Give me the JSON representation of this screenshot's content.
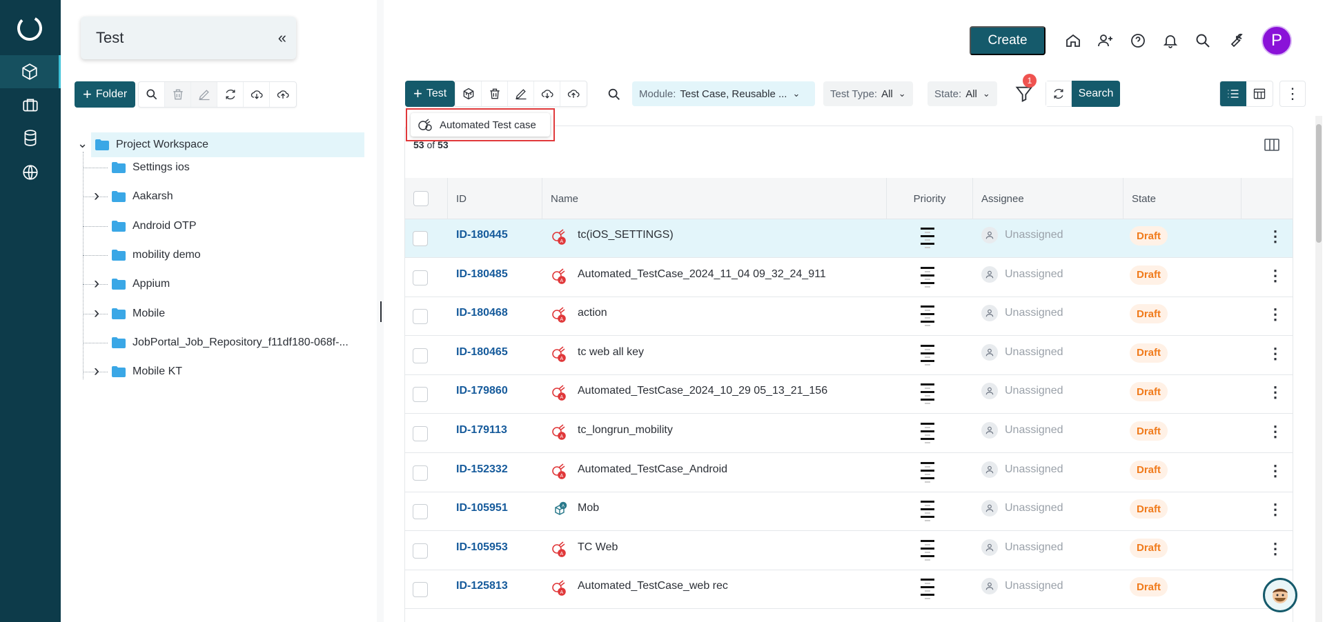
{
  "nav": {
    "items": [
      "logo-icon",
      "cube-icon",
      "briefcase-icon",
      "database-icon",
      "globe-icon"
    ]
  },
  "project": {
    "title": "Test",
    "collapse_glyph": "«"
  },
  "folder_toolbar": {
    "add_folder_label": "Folder"
  },
  "tree": {
    "root": "Project Workspace",
    "items": [
      {
        "label": "Settings ios",
        "expandable": false
      },
      {
        "label": "Aakarsh",
        "expandable": true
      },
      {
        "label": "Android OTP",
        "expandable": false
      },
      {
        "label": "mobility demo",
        "expandable": false
      },
      {
        "label": "Appium",
        "expandable": true
      },
      {
        "label": "Mobile",
        "expandable": true
      },
      {
        "label": "JobPortal_Job_Repository_f11df180-068f-...",
        "expandable": false
      },
      {
        "label": "Mobile KT",
        "expandable": true
      }
    ]
  },
  "header": {
    "create_label": "Create",
    "avatar_initial": "P"
  },
  "toolbar": {
    "add_test_label": "Test",
    "filters": {
      "module_label": "Module:",
      "module_value": "Test Case, Reusable ...",
      "type_label": "Test Type:",
      "type_value": "All",
      "state_label": "State:",
      "state_value": "All"
    },
    "filter_badge": "1",
    "search_label": "Search"
  },
  "dropdown": {
    "item": "Automated Test case"
  },
  "table": {
    "count_shown": "53",
    "count_of": "of",
    "count_total": "53",
    "columns": {
      "id": "ID",
      "name": "Name",
      "priority": "Priority",
      "assignee": "Assignee",
      "state": "State"
    },
    "rows": [
      {
        "id": "ID-180445",
        "name": "tc(iOS_SETTINGS)",
        "assignee": "Unassigned",
        "state": "Draft",
        "type": "automated-mobile"
      },
      {
        "id": "ID-180485",
        "name": "Automated_TestCase_2024_11_04 09_32_24_911",
        "assignee": "Unassigned",
        "state": "Draft",
        "type": "automated-mobile"
      },
      {
        "id": "ID-180468",
        "name": "action",
        "assignee": "Unassigned",
        "state": "Draft",
        "type": "automated-mobile"
      },
      {
        "id": "ID-180465",
        "name": "tc web all key",
        "assignee": "Unassigned",
        "state": "Draft",
        "type": "automated-mobile"
      },
      {
        "id": "ID-179860",
        "name": "Automated_TestCase_2024_10_29 05_13_21_156",
        "assignee": "Unassigned",
        "state": "Draft",
        "type": "automated-mobile"
      },
      {
        "id": "ID-179113",
        "name": "tc_longrun_mobility",
        "assignee": "Unassigned",
        "state": "Draft",
        "type": "automated-mobile"
      },
      {
        "id": "ID-152332",
        "name": "Automated_TestCase_Android",
        "assignee": "Unassigned",
        "state": "Draft",
        "type": "automated-mobile"
      },
      {
        "id": "ID-105951",
        "name": "Mob",
        "assignee": "Unassigned",
        "state": "Draft",
        "type": "reusable"
      },
      {
        "id": "ID-105953",
        "name": "TC Web",
        "assignee": "Unassigned",
        "state": "Draft",
        "type": "automated-mobile"
      },
      {
        "id": "ID-125813",
        "name": "Automated_TestCase_web rec",
        "assignee": "Unassigned",
        "state": "Draft",
        "type": "automated-mobile"
      }
    ]
  },
  "colors": {
    "brand": "#155a6b",
    "rail": "#0d3b4a",
    "draft": "#f07a1a",
    "link": "#155a9b",
    "highlight": "#e0383a"
  }
}
